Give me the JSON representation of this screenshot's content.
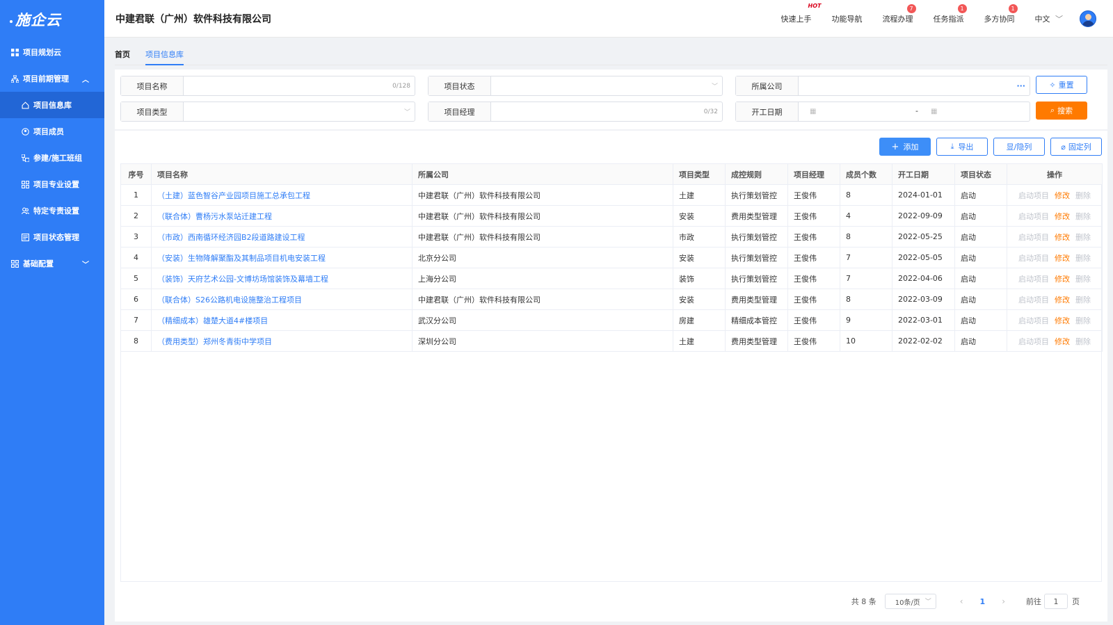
{
  "sidebar": {
    "logo": "施企云",
    "items": [
      {
        "label": "项目规划云",
        "icon": "grid-icon"
      },
      {
        "label": "项目前期管理",
        "icon": "org-chart-icon"
      },
      {
        "label": "项目信息库",
        "icon": "home-icon"
      },
      {
        "label": "项目成员",
        "icon": "members-icon"
      },
      {
        "label": "参建/施工班组",
        "icon": "team-icon"
      },
      {
        "label": "项目专业设置",
        "icon": "apps-icon"
      },
      {
        "label": "特定专责设置",
        "icon": "people-icon"
      },
      {
        "label": "项目状态管理",
        "icon": "status-icon"
      },
      {
        "label": "基础配置",
        "icon": "apps-icon"
      }
    ]
  },
  "header": {
    "company": "中建君联（广州）软件科技有限公司",
    "quick_start": "快速上手",
    "hot": "HOT",
    "func_nav": "功能导航",
    "process": "流程办理",
    "process_badge": "7",
    "task": "任务指派",
    "task_badge": "1",
    "collab": "多方协同",
    "collab_badge": "1",
    "lang": "中文"
  },
  "tabs": {
    "home": "首页",
    "current": "项目信息库"
  },
  "filter": {
    "name_label": "项目名称",
    "name_count": "0/128",
    "status_label": "项目状态",
    "company_label": "所属公司",
    "company_more": "···",
    "reset_label": "重置",
    "type_label": "项目类型",
    "manager_label": "项目经理",
    "manager_count": "0/32",
    "date_label": "开工日期",
    "date_sep": "-",
    "search_label": "搜索"
  },
  "toolbar": {
    "add": "添加",
    "export": "导出",
    "toggle_cols": "显/隐列",
    "fix_cols": "固定列"
  },
  "table": {
    "headers": [
      "序号",
      "项目名称",
      "所属公司",
      "项目类型",
      "成控规则",
      "项目经理",
      "成员个数",
      "开工日期",
      "项目状态",
      "操作"
    ],
    "op_start": "启动项目",
    "op_edit": "修改",
    "op_delete": "删除",
    "rows": [
      [
        "1",
        "（土建）蓝色智谷产业园项目施工总承包工程",
        "中建君联（广州）软件科技有限公司",
        "土建",
        "执行策划管控",
        "王俊伟",
        "8",
        "2024-01-01",
        "启动"
      ],
      [
        "2",
        "（联合体）曹杨污水泵站迁建工程",
        "中建君联（广州）软件科技有限公司",
        "安装",
        "费用类型管理",
        "王俊伟",
        "4",
        "2022-09-09",
        "启动"
      ],
      [
        "3",
        "（市政）西南循环经济园B2段道路建设工程",
        "中建君联（广州）软件科技有限公司",
        "市政",
        "执行策划管控",
        "王俊伟",
        "8",
        "2022-05-25",
        "启动"
      ],
      [
        "4",
        "（安装）生物降解聚酯及其制品项目机电安装工程",
        "北京分公司",
        "安装",
        "执行策划管控",
        "王俊伟",
        "7",
        "2022-05-05",
        "启动"
      ],
      [
        "5",
        "（装饰）天府艺术公园-文博坊场馆装饰及幕墙工程",
        "上海分公司",
        "装饰",
        "执行策划管控",
        "王俊伟",
        "7",
        "2022-04-06",
        "启动"
      ],
      [
        "6",
        "（联合体）S26公路机电设施整治工程项目",
        "中建君联（广州）软件科技有限公司",
        "安装",
        "费用类型管理",
        "王俊伟",
        "8",
        "2022-03-09",
        "启动"
      ],
      [
        "7",
        "（精细成本）雄楚大道4#楼项目",
        "武汉分公司",
        "房建",
        "精细成本管控",
        "王俊伟",
        "9",
        "2022-03-01",
        "启动"
      ],
      [
        "8",
        "（费用类型）郑州冬青街中学项目",
        "深圳分公司",
        "土建",
        "费用类型管理",
        "王俊伟",
        "10",
        "2022-02-02",
        "启动"
      ]
    ]
  },
  "pager": {
    "total": "共 8 条",
    "size": "10条/页",
    "current": "1",
    "goto": "前往",
    "goto_value": "1",
    "page_unit": "页"
  }
}
